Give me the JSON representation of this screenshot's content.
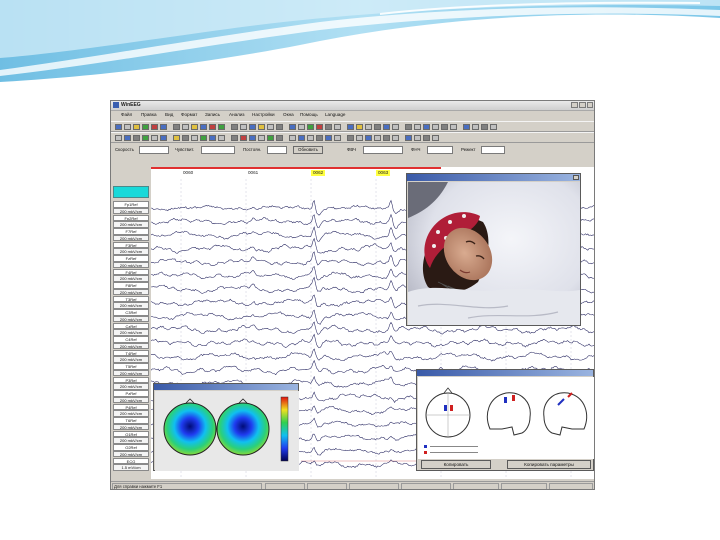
{
  "app": {
    "title": "WinEEG"
  },
  "menu": [
    "Файл",
    "Правка",
    "Вид",
    "Формат",
    "Запись",
    "Анализ",
    "Настройки",
    "Окна",
    "Помощь",
    "Language"
  ],
  "params": {
    "speed_label": "Скорость",
    "sens_label": "Чувствит.",
    "const_label": "Постоян.",
    "refresh_label": "Обновить",
    "hpf_label": "ФВЧ",
    "lpf_label": "ФНЧ",
    "notch_label": "Режект"
  },
  "toolbar_icons": {
    "row1": [
      "#4a6ec0",
      "#c0c0c0",
      "#e0c040",
      "#40a040",
      "#c04040",
      "#4a6ec0",
      "#808080",
      "#c0c0c0",
      "#e0c040",
      "#4a6ec0",
      "#c04040",
      "#40a040",
      "#808080",
      "#c0c0c0",
      "#4a6ec0",
      "#e0c040",
      "#c0c0c0",
      "#808080",
      "#4a6ec0",
      "#c0c0c0",
      "#40a040",
      "#c04040",
      "#808080",
      "#c0c0c0",
      "#4a6ec0",
      "#e0c040",
      "#c0c0c0",
      "#808080",
      "#4a6ec0",
      "#c0c0c0",
      "#808080",
      "#c0c0c0",
      "#4a6ec0",
      "#c0c0c0",
      "#808080",
      "#c0c0c0",
      "#4a6ec0",
      "#c0c0c0",
      "#808080",
      "#c0c0c0"
    ],
    "row2": [
      "#c0c0c0",
      "#4a6ec0",
      "#808080",
      "#40a040",
      "#c0c0c0",
      "#4a6ec0",
      "#e0c040",
      "#808080",
      "#c0c0c0",
      "#40a040",
      "#4a6ec0",
      "#c0c0c0",
      "#808080",
      "#c04040",
      "#4a6ec0",
      "#c0c0c0",
      "#40a040",
      "#808080",
      "#c0c0c0",
      "#4a6ec0",
      "#c0c0c0",
      "#808080",
      "#4a6ec0",
      "#c0c0c0",
      "#808080",
      "#c0c0c0",
      "#4a6ec0",
      "#c0c0c0",
      "#808080",
      "#c0c0c0",
      "#4a6ec0",
      "#c0c0c0",
      "#808080",
      "#c0c0c0"
    ]
  },
  "timeline": {
    "marks": [
      "0060",
      "0061",
      "0062",
      "0063"
    ],
    "highlighted": [
      "0062",
      "0063"
    ],
    "highlight_color": "#ffff40",
    "marker_color": "#e03030"
  },
  "channels": [
    {
      "name": "Fp1Ref",
      "scale": "200 mkV/cm"
    },
    {
      "name": "Fp2Ref",
      "scale": "200 mkV/cm"
    },
    {
      "name": "F7Ref",
      "scale": "200 mkV/cm"
    },
    {
      "name": "F3Ref",
      "scale": "200 mkV/cm"
    },
    {
      "name": "FzRef",
      "scale": "200 mkV/cm"
    },
    {
      "name": "F4Ref",
      "scale": "200 mkV/cm"
    },
    {
      "name": "F8Ref",
      "scale": "200 mkV/cm"
    },
    {
      "name": "T3Ref",
      "scale": "200 mkV/cm"
    },
    {
      "name": "C3Ref",
      "scale": "200 mkV/cm"
    },
    {
      "name": "CzRef",
      "scale": "200 mkV/cm"
    },
    {
      "name": "C4Ref",
      "scale": "200 mkV/cm"
    },
    {
      "name": "T4Ref",
      "scale": "200 mkV/cm"
    },
    {
      "name": "T5Ref",
      "scale": "200 mkV/cm"
    },
    {
      "name": "P3Ref",
      "scale": "200 mkV/cm"
    },
    {
      "name": "PzRef",
      "scale": "200 mkV/cm"
    },
    {
      "name": "P4Ref",
      "scale": "200 mkV/cm"
    },
    {
      "name": "T6Ref",
      "scale": "200 mkV/cm"
    },
    {
      "name": "O1Ref",
      "scale": "200 mkV/cm"
    },
    {
      "name": "O2Ref",
      "scale": "200 mkV/cm"
    },
    {
      "name": "ECG",
      "scale": "1.5 mV/cm"
    }
  ],
  "dipole": {
    "buttons": [
      "Копировать",
      "Копировать параметры"
    ]
  },
  "status": {
    "help": "Для справки нажмите F1"
  },
  "colors": {
    "selection": "#19d9d9",
    "trace": "#23235e",
    "dipole_left": "#2030c0",
    "dipole_right": "#d02020",
    "decor_blue": "#8fd0ee"
  }
}
